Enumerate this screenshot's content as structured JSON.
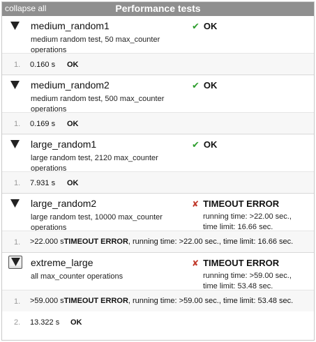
{
  "header": {
    "collapse_label": "collapse all",
    "title": "Performance tests"
  },
  "icons": {
    "expanded": "triangle-down-icon",
    "ok": "check-icon",
    "error": "cross-icon"
  },
  "colors": {
    "header_bg": "#8f8f8f",
    "ok_mark": "#2e9e2e",
    "error_mark": "#c0392b"
  },
  "tests": [
    {
      "name": "medium_random1",
      "desc": "medium random test, 50 max_counter operations",
      "status_mark": "✔",
      "status": "OK",
      "results": [
        {
          "num": "1.",
          "time": "0.160 s",
          "status": "OK"
        }
      ]
    },
    {
      "name": "medium_random2",
      "desc": "medium random test, 500 max_counter operations",
      "status_mark": "✔",
      "status": "OK",
      "results": [
        {
          "num": "1.",
          "time": "0.169 s",
          "status": "OK"
        }
      ]
    },
    {
      "name": "large_random1",
      "desc": "large random test, 2120 max_counter operations",
      "status_mark": "✔",
      "status": "OK",
      "results": [
        {
          "num": "1.",
          "time": "7.931 s",
          "status": "OK"
        }
      ]
    },
    {
      "name": "large_random2",
      "desc": "large random test, 10000 max_counter operations",
      "status_mark": "✘",
      "status": "TIMEOUT ERROR",
      "detail_line1": "running time: >22.00 sec.,",
      "detail_line2": "time limit: 16.66 sec.",
      "results": [
        {
          "num": "1.",
          "time": ">22.000 s",
          "status": "TIMEOUT ERROR",
          "rest": ", running time: >22.00 sec., time limit: 16.66 sec."
        }
      ]
    },
    {
      "name": "extreme_large",
      "desc": "all max_counter operations",
      "status_mark": "✘",
      "status": "TIMEOUT ERROR",
      "detail_line1": "running time: >59.00 sec.,",
      "detail_line2": "time limit: 53.48 sec.",
      "results": [
        {
          "num": "1.",
          "time": ">59.000 s",
          "status": "TIMEOUT ERROR",
          "rest": ", running time: >59.00 sec., time limit: 53.48 sec."
        },
        {
          "num": "2.",
          "time": "13.322 s",
          "status": "OK"
        }
      ]
    }
  ]
}
